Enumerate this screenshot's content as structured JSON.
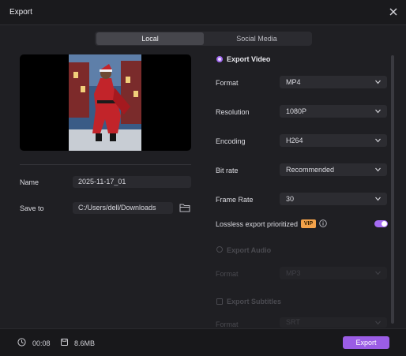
{
  "window": {
    "title": "Export"
  },
  "tabs": {
    "local": "Local",
    "social": "Social Media"
  },
  "file": {
    "name_label": "Name",
    "name_value": "2025-11-17_01",
    "save_label": "Save to",
    "save_value": "C:/Users/dell/Downloads"
  },
  "video": {
    "section": "Export Video",
    "format_label": "Format",
    "format_value": "MP4",
    "resolution_label": "Resolution",
    "resolution_value": "1080P",
    "encoding_label": "Encoding",
    "encoding_value": "H264",
    "bitrate_label": "Bit rate",
    "bitrate_value": "Recommended",
    "framerate_label": "Frame Rate",
    "framerate_value": "30",
    "lossless_label": "Lossless export prioritized",
    "vip_badge": "VIP"
  },
  "audio": {
    "section": "Export Audio",
    "format_label": "Format",
    "format_value": "MP3"
  },
  "subtitles": {
    "section": "Export Subtitles",
    "format_label": "Format",
    "format_value": "SRT"
  },
  "footer": {
    "duration": "00:08",
    "size": "8.6MB",
    "export_button": "Export"
  },
  "colors": {
    "accent": "#9b5de5",
    "vip": "#f3a24a",
    "background": "#1f1f23"
  }
}
